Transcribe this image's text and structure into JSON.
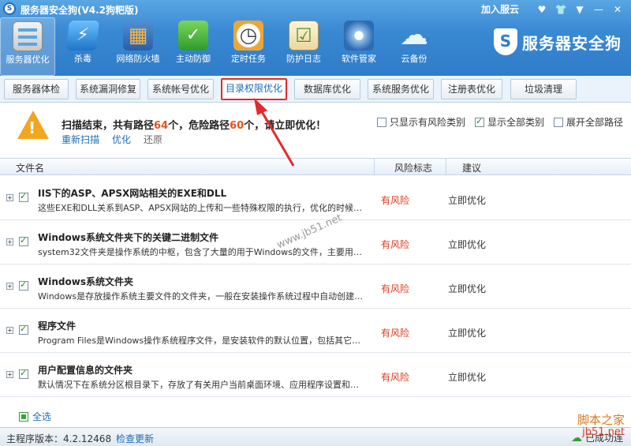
{
  "window": {
    "title": "服务器安全狗(V4.2狗粑版)",
    "join_cloud": "加入服云",
    "buttons": [
      "user-icon",
      "shirt-icon",
      "menu-icon",
      "minimize-icon",
      "close-icon"
    ]
  },
  "toolbar": {
    "items": [
      {
        "label": "服务器优化",
        "icon": "server-icon",
        "active": true
      },
      {
        "label": "杀毒",
        "icon": "antivirus-icon"
      },
      {
        "label": "网络防火墙",
        "icon": "firewall-icon"
      },
      {
        "label": "主动防御",
        "icon": "shield-icon"
      },
      {
        "label": "定时任务",
        "icon": "clock-icon"
      },
      {
        "label": "防护日志",
        "icon": "log-icon"
      },
      {
        "label": "软件管家",
        "icon": "software-icon"
      },
      {
        "label": "云备份",
        "icon": "cloud-icon"
      }
    ],
    "brand": "服务器安全狗"
  },
  "subtabs": [
    {
      "label": "服务器体检"
    },
    {
      "label": "系统漏洞修复"
    },
    {
      "label": "系统帐号优化"
    },
    {
      "label": "目录权限优化",
      "active": true
    },
    {
      "label": "数据库优化"
    },
    {
      "label": "系统服务优化"
    },
    {
      "label": "注册表优化"
    },
    {
      "label": "垃圾清理"
    }
  ],
  "summary": {
    "prefix": "扫描结束，共有路径",
    "total": "64",
    "mid": "个，危险路径",
    "danger": "60",
    "suffix": "个，请立即优化！",
    "links": {
      "rescan": "重新扫描",
      "optimize": "优化",
      "restore": "还原"
    },
    "filters": [
      {
        "label": "只显示有风险类别",
        "checked": false
      },
      {
        "label": "显示全部类别",
        "checked": true
      },
      {
        "label": "展开全部路径",
        "checked": false
      }
    ]
  },
  "table": {
    "headers": {
      "file": "文件名",
      "risk": "风险标志",
      "advice": "建议"
    },
    "rows": [
      {
        "title": "IIS下的ASP、APSX网站相关的EXE和DLL",
        "desc": "这些EXE和DLL关系到ASP、APSX网站的上传和一些特殊权限的执行，优化的时候请…",
        "risk": "有风险",
        "advice": "立即优化"
      },
      {
        "title": "Windows系统文件夹下的关键二进制文件",
        "desc": "system32文件夹是操作系统的中枢，包含了大量的用于Windows的文件，主要用于存…",
        "risk": "有风险",
        "advice": "立即优化"
      },
      {
        "title": "Windows系统文件夹",
        "desc": "Windows是存放操作系统主要文件的文件夹，一般在安装操作系统过程中自动创建并…",
        "risk": "有风险",
        "advice": "立即优化"
      },
      {
        "title": "程序文件",
        "desc": "Program Files是Windows操作系统程序文件，是安装软件的默认位置，包括其它的操…",
        "risk": "有风险",
        "advice": "立即优化"
      },
      {
        "title": "用户配置信息的文件夹",
        "desc": "默认情况下在系统分区根目录下，存放了有关用户当前桌面环境、应用程序设置和…",
        "risk": "有风险",
        "advice": "立即优化"
      }
    ],
    "select_all": "全选"
  },
  "status": {
    "version": "主程序版本：4.2.12468",
    "check_update": "检查更新",
    "cloud": "已成功连"
  },
  "overlay": {
    "watermark": "www.jb51.net",
    "site_cn": "脚本之家",
    "site_url": "jb51.net"
  },
  "colors": {
    "accent": "#2f7cc8",
    "risk": "#e03a1d",
    "highlight": "#e4292c"
  }
}
